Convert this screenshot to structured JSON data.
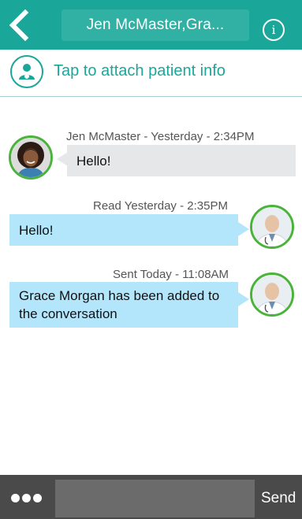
{
  "header": {
    "title": "Jen McMaster,Gra...",
    "back_icon": "chevron-left-icon",
    "info_icon": "info-icon",
    "info_glyph": "i"
  },
  "attach": {
    "icon": "patient-icon",
    "label": "Tap to attach patient info"
  },
  "messages": [
    {
      "direction": "incoming",
      "meta": "Jen McMaster - Yesterday - 2:34PM",
      "text": "Hello!"
    },
    {
      "direction": "outgoing",
      "meta": "Read Yesterday - 2:35PM",
      "text": "Hello!"
    },
    {
      "direction": "outgoing",
      "meta": "Sent Today - 11:08AM",
      "text": "Grace Morgan has been added to the conversation"
    }
  ],
  "composer": {
    "more_icon": "more-dots-icon",
    "input_value": "",
    "send_label": "Send"
  },
  "colors": {
    "brand": "#1aa79a",
    "incoming_bubble": "#e6e7e9",
    "outgoing_bubble": "#b4e6fb",
    "avatar_ring": "#49b33a",
    "bottom_bar": "#4a4a4a"
  }
}
